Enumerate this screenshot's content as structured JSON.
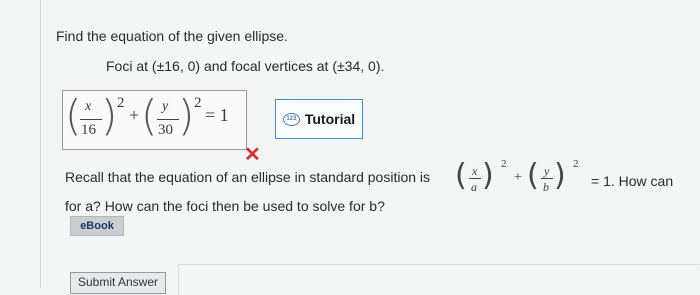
{
  "question": {
    "prompt": "Find the equation of the given ellipse.",
    "given": "Foci at (±16, 0) and focal vertices at (±34, 0)."
  },
  "answer": {
    "x_var": "x",
    "x_den": "16",
    "x_exp": "2",
    "plus": "+",
    "y_var": "y",
    "y_den": "30",
    "y_exp": "2",
    "equals": "= 1",
    "status": "incorrect"
  },
  "tutorial": {
    "label": "Tutorial",
    "icon": "tutorial-icon",
    "icon_text": "123"
  },
  "feedback": {
    "mark": "✕",
    "mark_color": "#d42f2f",
    "line1": "Recall that the equation of an ellipse in standard position is",
    "formula": {
      "x_num": "x",
      "x_den": "a",
      "x_exp": "2",
      "plus": "+",
      "y_num": "y",
      "y_den": "b",
      "y_exp": "2"
    },
    "line1_tail": "= 1. How can",
    "line2": "for a? How can the foci then be used to solve for b?"
  },
  "ebook": {
    "label": "eBook"
  },
  "submit": {
    "label": "Submit Answer"
  },
  "colors": {
    "accent": "#3f8fd0",
    "error": "#d42f2f",
    "background": "#f4f5f5"
  }
}
